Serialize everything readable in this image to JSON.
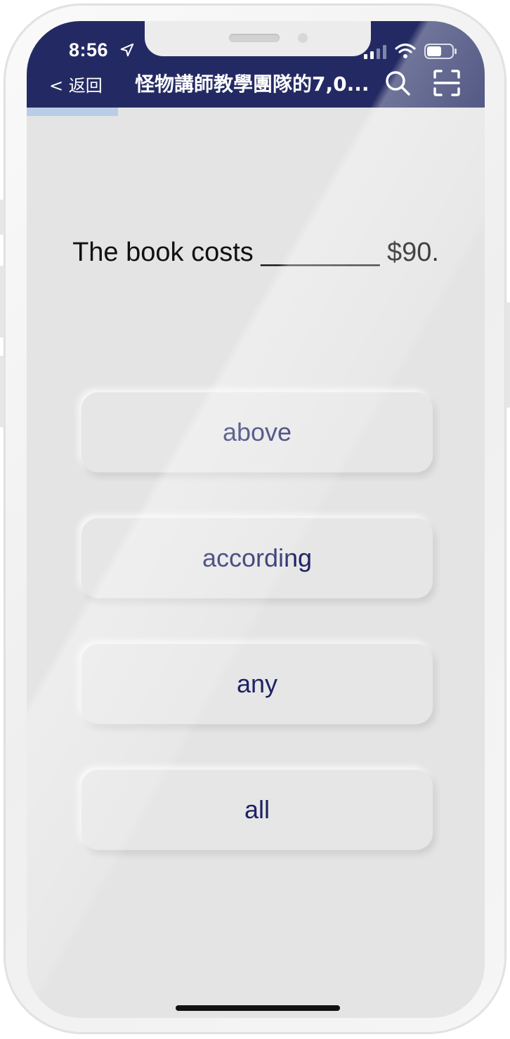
{
  "status_bar": {
    "time": "8:56"
  },
  "nav": {
    "back_label": "< 返回",
    "title": "怪物講師教學團隊的7,0...",
    "icons": [
      "location-arrow-icon",
      "signal-icon",
      "wifi-icon",
      "battery-icon",
      "search-icon",
      "scan-icon"
    ]
  },
  "progress": {
    "fraction": 0.2
  },
  "quiz": {
    "question": "The book costs ________  $90.",
    "options": [
      {
        "label": "above"
      },
      {
        "label": "according"
      },
      {
        "label": "any"
      },
      {
        "label": "all"
      }
    ]
  },
  "colors": {
    "header_bg": "#232a63",
    "progress_fill": "#b9cde6",
    "option_text": "#1d2263",
    "screen_bg": "#e4e4e4"
  }
}
